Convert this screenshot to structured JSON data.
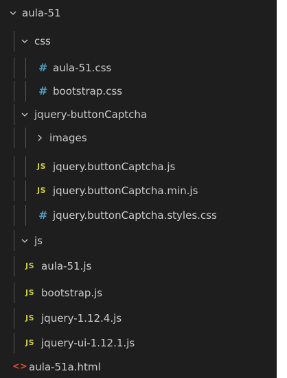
{
  "explorer": {
    "items": [
      {
        "label": "aula-51",
        "kind": "folder",
        "expanded": true,
        "icon": "chevron-down-icon"
      },
      {
        "label": "css",
        "kind": "folder",
        "expanded": true,
        "icon": "chevron-down-icon"
      },
      {
        "label": "aula-51.css",
        "kind": "file",
        "icon": "css-file-icon",
        "glyph": "#"
      },
      {
        "label": "bootstrap.css",
        "kind": "file",
        "icon": "css-file-icon",
        "glyph": "#"
      },
      {
        "label": "jquery-buttonCaptcha",
        "kind": "folder",
        "expanded": true,
        "icon": "chevron-down-icon"
      },
      {
        "label": "images",
        "kind": "folder",
        "expanded": false,
        "icon": "chevron-right-icon"
      },
      {
        "label": "jquery.buttonCaptcha.js",
        "kind": "file",
        "icon": "js-file-icon",
        "glyph": "JS"
      },
      {
        "label": "jquery.buttonCaptcha.min.js",
        "kind": "file",
        "icon": "js-file-icon",
        "glyph": "JS"
      },
      {
        "label": "jquery.buttonCaptcha.styles.css",
        "kind": "file",
        "icon": "css-file-icon",
        "glyph": "#"
      },
      {
        "label": "js",
        "kind": "folder",
        "expanded": true,
        "icon": "chevron-down-icon"
      },
      {
        "label": "aula-51.js",
        "kind": "file",
        "icon": "js-file-icon",
        "glyph": "JS"
      },
      {
        "label": "bootstrap.js",
        "kind": "file",
        "icon": "js-file-icon",
        "glyph": "JS"
      },
      {
        "label": "jquery-1.12.4.js",
        "kind": "file",
        "icon": "js-file-icon",
        "glyph": "JS"
      },
      {
        "label": "jquery-ui-1.12.1.js",
        "kind": "file",
        "icon": "js-file-icon",
        "glyph": "JS"
      },
      {
        "label": "aula-51a.html",
        "kind": "file",
        "icon": "html-file-icon",
        "glyph": "<>"
      }
    ]
  },
  "colors": {
    "background": "#1e1e1e",
    "text": "#cccccc",
    "css_icon": "#519aba",
    "js_icon": "#cbcb41",
    "html_icon": "#e34c26",
    "indent_guide": "#585858"
  }
}
